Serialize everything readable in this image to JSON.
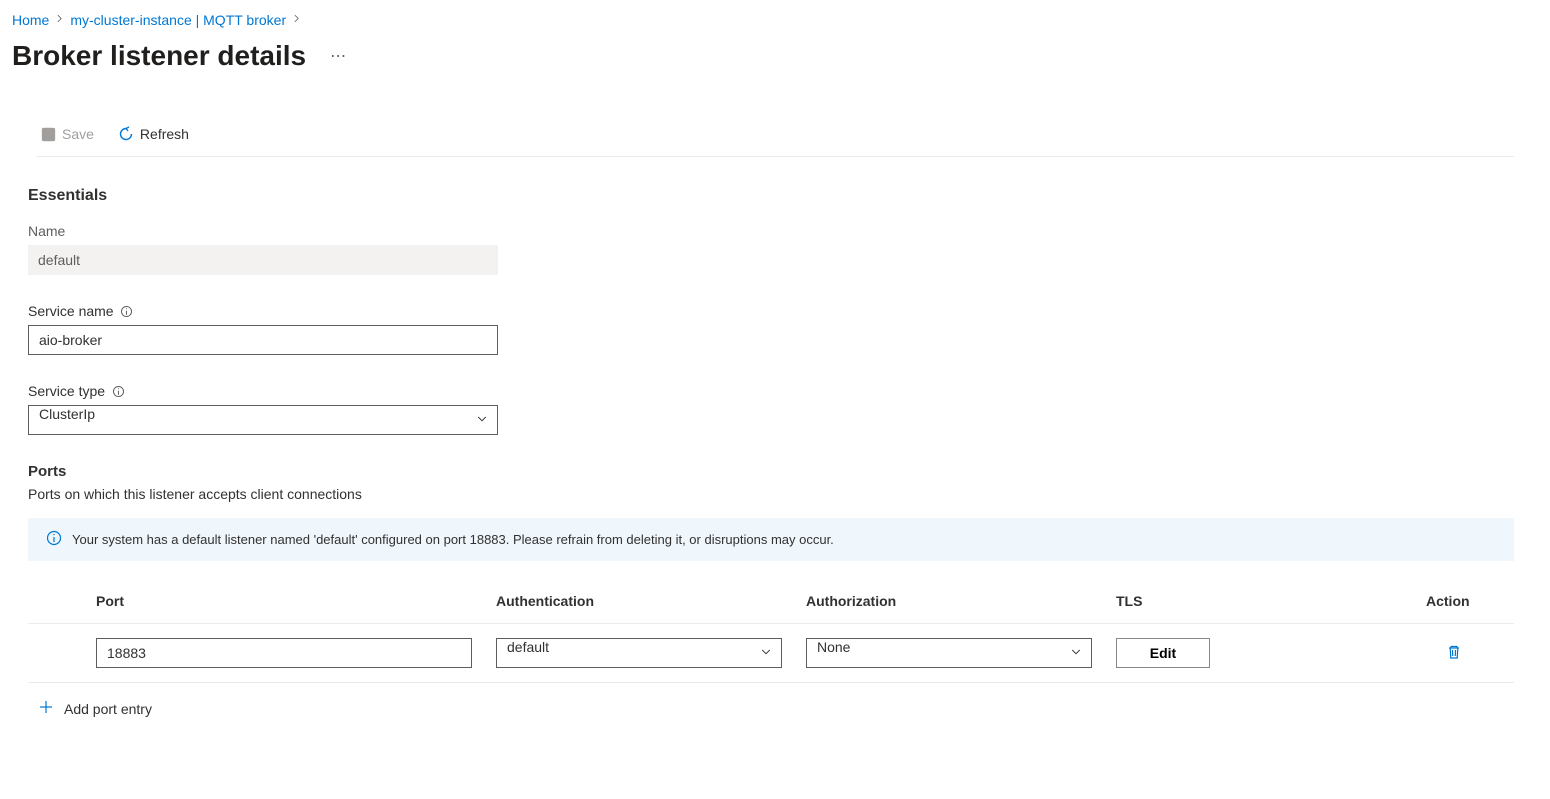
{
  "breadcrumb": {
    "items": [
      {
        "label": "Home"
      },
      {
        "label": "my-cluster-instance | MQTT broker"
      }
    ]
  },
  "page": {
    "title": "Broker listener details"
  },
  "toolbar": {
    "save_label": "Save",
    "refresh_label": "Refresh"
  },
  "essentials": {
    "section_title": "Essentials",
    "name_label": "Name",
    "name_value": "default",
    "service_name_label": "Service name",
    "service_name_value": "aio-broker",
    "service_type_label": "Service type",
    "service_type_value": "ClusterIp"
  },
  "ports": {
    "section_title": "Ports",
    "description": "Ports on which this listener accepts client connections",
    "banner": "Your system has a default listener named 'default' configured on port 18883. Please refrain from deleting it, or disruptions may occur.",
    "columns": {
      "port": "Port",
      "auth": "Authentication",
      "authz": "Authorization",
      "tls": "TLS",
      "action": "Action"
    },
    "rows": [
      {
        "port": "18883",
        "auth": "default",
        "authz": "None",
        "tls_label": "Edit"
      }
    ],
    "add_label": "Add port entry"
  }
}
